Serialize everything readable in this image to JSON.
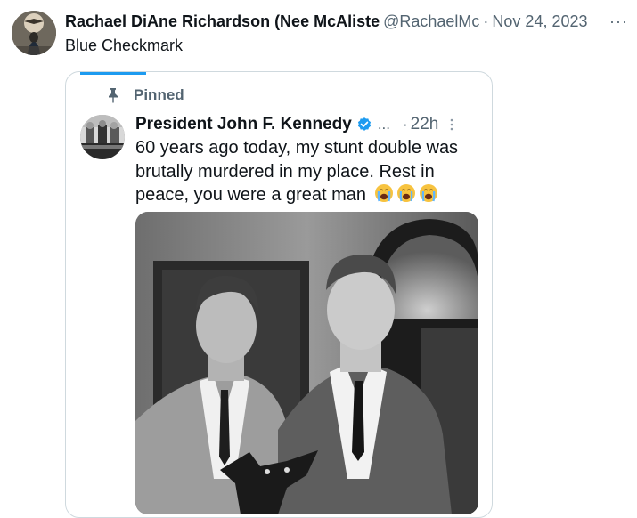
{
  "post": {
    "author_name": "Rachael DiAne Richardson (Nee McAliste",
    "handle": "@RachaelMc",
    "separator": "·",
    "date": "Nov 24, 2023",
    "more_label": "···",
    "text": "Blue Checkmark"
  },
  "quote": {
    "pinned_label": "Pinned",
    "author_name": "President John F. Kennedy",
    "ellipsis": "...",
    "separator": "·",
    "time": "22h",
    "text": "60 years ago today, my stunt double was brutally murdered in my place. Rest in peace, you were a great man",
    "emojis": [
      "loudly-crying-face-emoji",
      "loudly-crying-face-emoji",
      "loudly-crying-face-emoji"
    ]
  },
  "colors": {
    "accent": "#1d9bf0",
    "text": "#0f1419",
    "secondary": "#536471",
    "border": "#cfd9de",
    "emoji": "#f7c33f"
  }
}
